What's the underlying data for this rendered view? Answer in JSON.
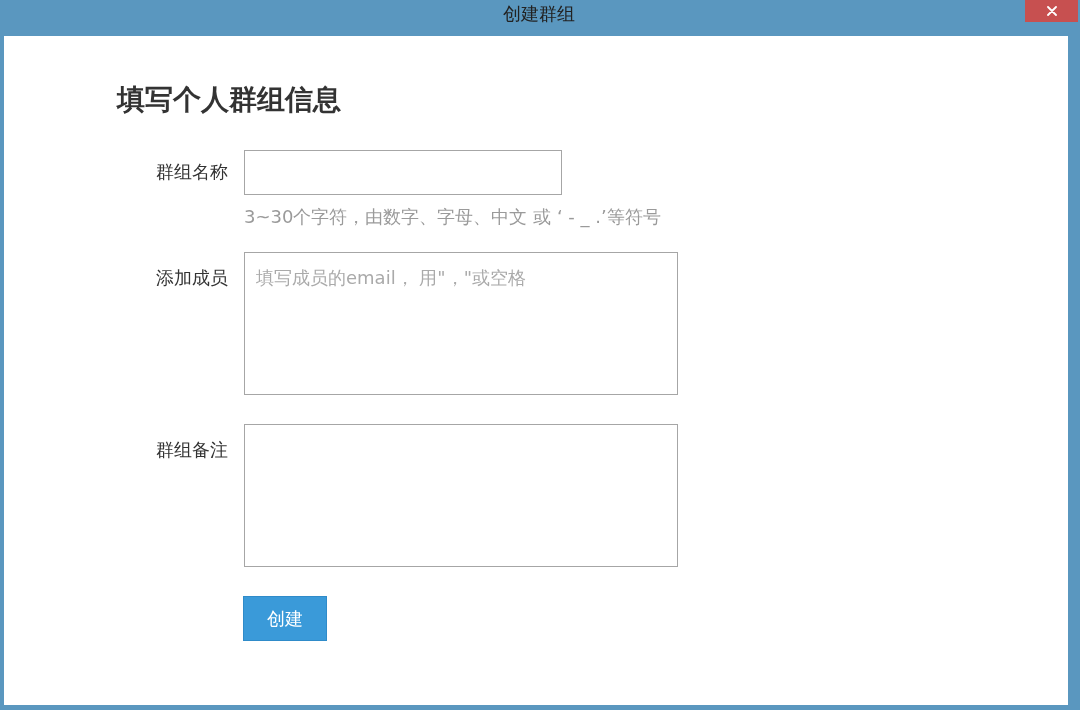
{
  "window": {
    "title": "创建群组"
  },
  "form": {
    "heading": "填写个人群组信息",
    "fields": [
      {
        "kind": "input",
        "label": "群组名称",
        "hint": "3~30个字符，由数字、字母、中文 或 ‘ - _ .’等符号"
      },
      {
        "kind": "textarea",
        "label": "添加成员",
        "placeholder": "填写成员的email， 用\"，\"或空格"
      },
      {
        "kind": "textarea",
        "label": "群组备注"
      }
    ],
    "submit_button": "创建"
  }
}
